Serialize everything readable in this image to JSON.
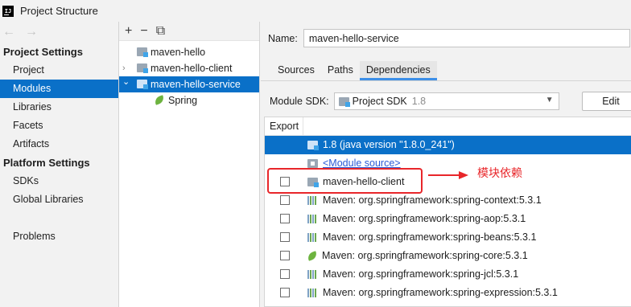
{
  "window": {
    "title": "Project Structure",
    "app_icon_text": "IJ"
  },
  "nav": {
    "back_icon": "←",
    "forward_icon": "→",
    "project_settings_header": "Project Settings",
    "project_settings_items": [
      "Project",
      "Modules",
      "Libraries",
      "Facets",
      "Artifacts"
    ],
    "platform_settings_header": "Platform Settings",
    "platform_settings_items": [
      "SDKs",
      "Global Libraries"
    ],
    "other_items": [
      "Problems"
    ],
    "selected": "Modules"
  },
  "tree": {
    "toolbar": {
      "add": "+",
      "remove": "−",
      "copy": "⧉"
    },
    "items": [
      {
        "label": "maven-hello",
        "icon": "module-folder-icon",
        "chevron": ""
      },
      {
        "label": "maven-hello-client",
        "icon": "module-folder-icon",
        "chevron": "›"
      },
      {
        "label": "maven-hello-service",
        "icon": "module-folder-icon",
        "chevron": "⌄",
        "selected": true
      },
      {
        "label": "Spring",
        "icon": "spring-leaf-icon",
        "chevron": ""
      }
    ]
  },
  "module": {
    "name_label": "Name:",
    "name_value": "maven-hello-service",
    "tabs": [
      "Sources",
      "Paths",
      "Dependencies"
    ],
    "active_tab": "Dependencies",
    "sdk_label": "Module SDK:",
    "sdk_value": "Project SDK",
    "sdk_version": "1.8",
    "edit_label": "Edit",
    "export_header": "Export",
    "dependencies": [
      {
        "label": "1.8 (java version \"1.8.0_241\")",
        "icon": "jdk-folder-icon",
        "checkbox": false,
        "selected": true,
        "link": false
      },
      {
        "label": "<Module source>",
        "icon": "source-folder-icon",
        "checkbox": false,
        "selected": false,
        "link": true
      },
      {
        "label": "maven-hello-client",
        "icon": "module-folder-icon",
        "checkbox": true,
        "selected": false,
        "link": false
      },
      {
        "label": "Maven: org.springframework:spring-context:5.3.1",
        "icon": "library-icon",
        "checkbox": true,
        "selected": false,
        "link": false
      },
      {
        "label": "Maven: org.springframework:spring-aop:5.3.1",
        "icon": "library-icon",
        "checkbox": true,
        "selected": false,
        "link": false
      },
      {
        "label": "Maven: org.springframework:spring-beans:5.3.1",
        "icon": "library-icon",
        "checkbox": true,
        "selected": false,
        "link": false
      },
      {
        "label": "Maven: org.springframework:spring-core:5.3.1",
        "icon": "spring-leaf-icon",
        "checkbox": true,
        "selected": false,
        "link": false
      },
      {
        "label": "Maven: org.springframework:spring-jcl:5.3.1",
        "icon": "library-icon",
        "checkbox": true,
        "selected": false,
        "link": false
      },
      {
        "label": "Maven: org.springframework:spring-expression:5.3.1",
        "icon": "library-icon",
        "checkbox": true,
        "selected": false,
        "link": false
      }
    ]
  },
  "annotation": {
    "text": "模块依赖",
    "color": "#e8262a"
  },
  "colors": {
    "selection": "#0a70c8",
    "tab_underline": "#3d8fe8",
    "link": "#2a5bd7"
  }
}
